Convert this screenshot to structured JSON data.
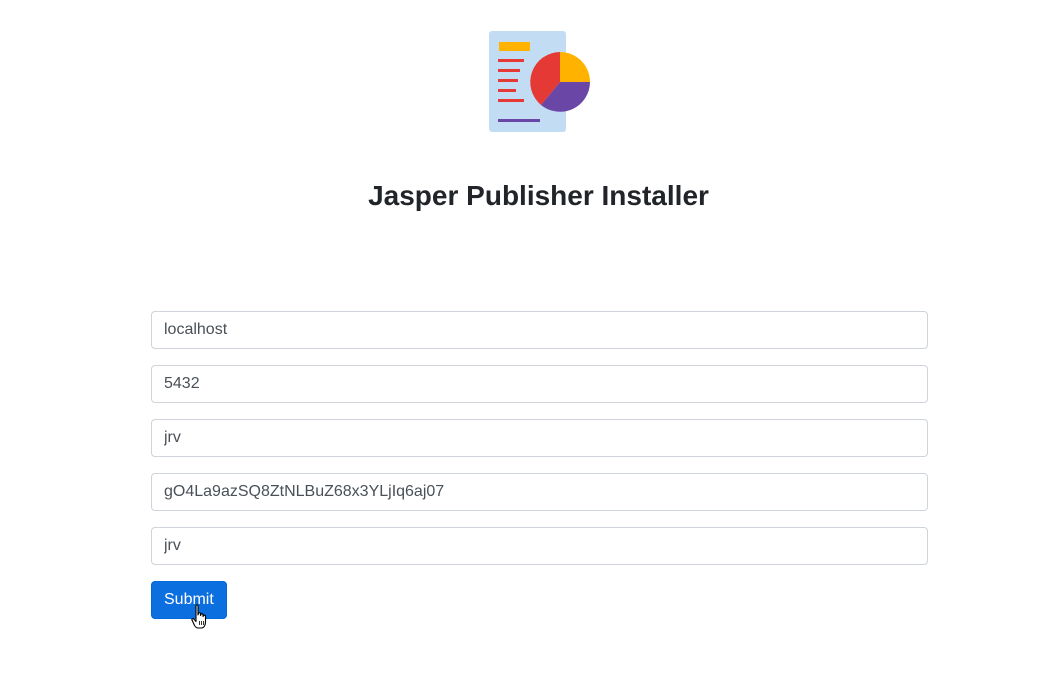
{
  "app": {
    "title": "Jasper Publisher Installer",
    "logo_icon": "report-chart-icon"
  },
  "form": {
    "fields": [
      {
        "name": "host",
        "value": "localhost"
      },
      {
        "name": "port",
        "value": "5432"
      },
      {
        "name": "user",
        "value": "jrv"
      },
      {
        "name": "password",
        "value": "gO4La9azSQ8ZtNLBuZ68x3YLjIq6aj07"
      },
      {
        "name": "database",
        "value": "jrv"
      }
    ],
    "submit_label": "Submit"
  },
  "colors": {
    "primary": "#0b6fe0",
    "logo_background": "#c2ddf3",
    "logo_lines_red": "#e53935",
    "logo_accent_yellow": "#ffb300",
    "logo_accent_purple": "#6a46a6"
  }
}
